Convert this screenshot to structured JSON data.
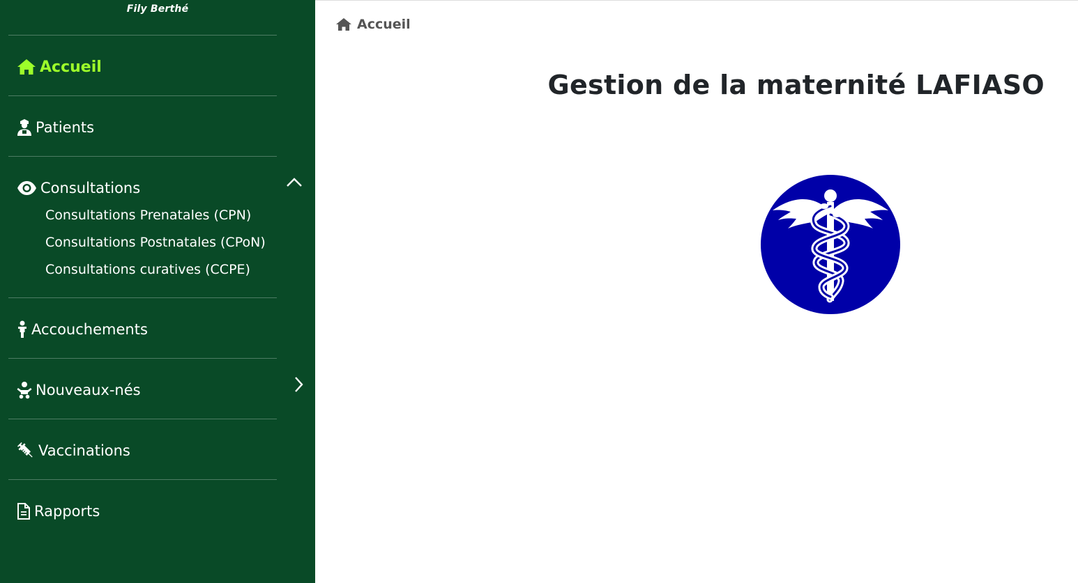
{
  "sidebar": {
    "user_name": "Fily Berthé",
    "items": [
      {
        "label": "Accueil",
        "icon": "home-icon",
        "active": true
      },
      {
        "label": "Patients",
        "icon": "user-nurse-icon"
      },
      {
        "label": "Consultations",
        "icon": "eye-icon",
        "expanded": true,
        "children": [
          {
            "label": "Consultations Prenatales (CPN)"
          },
          {
            "label": "Consultations Postnatales (CPoN)"
          },
          {
            "label": "Consultations curatives (CCPE)"
          }
        ]
      },
      {
        "label": "Accouchements",
        "icon": "child-icon"
      },
      {
        "label": "Nouveaux-nés",
        "icon": "baby-icon",
        "expandable": true
      },
      {
        "label": "Vaccinations",
        "icon": "syringe-icon"
      },
      {
        "label": "Rapports",
        "icon": "file-icon"
      }
    ]
  },
  "breadcrumb": {
    "label": "Accueil",
    "icon": "home-icon"
  },
  "main": {
    "title": "Gestion de la maternité LAFIASO",
    "logo_icon": "caduceus-icon"
  },
  "colors": {
    "sidebar_bg": "#094a27",
    "active_accent": "#9dff2a",
    "logo_blue": "#0000a8",
    "title_text": "#212529"
  }
}
